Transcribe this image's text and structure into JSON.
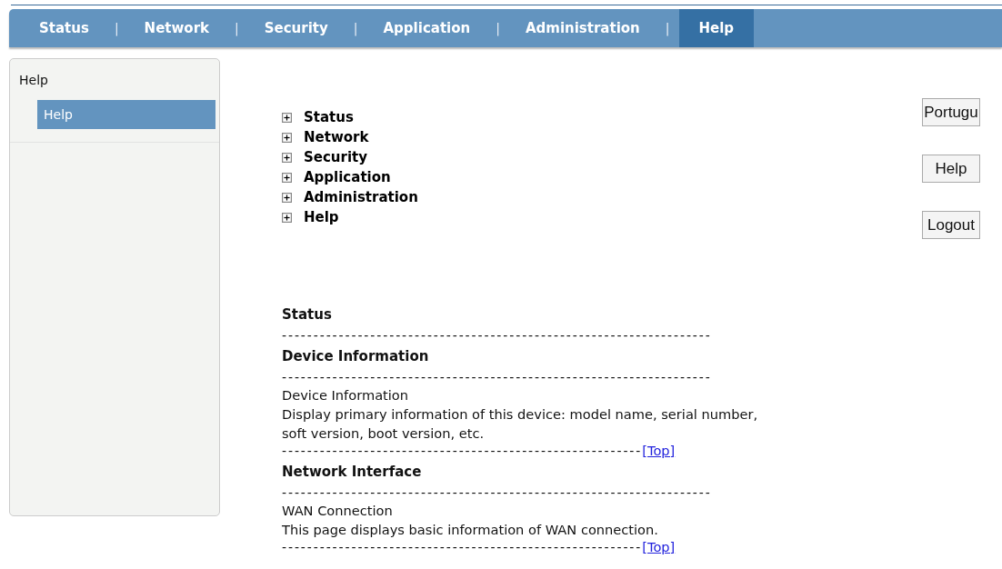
{
  "nav_tabs": [
    {
      "label": "Status",
      "selected": false
    },
    {
      "label": "Network",
      "selected": false
    },
    {
      "label": "Security",
      "selected": false
    },
    {
      "label": "Application",
      "selected": false
    },
    {
      "label": "Administration",
      "selected": false
    },
    {
      "label": "Help",
      "selected": true
    }
  ],
  "nav_separator": "|",
  "sidebar": {
    "title": "Help",
    "items": [
      {
        "label": "Help",
        "selected": true
      }
    ]
  },
  "tree": [
    {
      "label": "Status",
      "expanded": false
    },
    {
      "label": "Network",
      "expanded": false
    },
    {
      "label": "Security",
      "expanded": false
    },
    {
      "label": "Application",
      "expanded": false
    },
    {
      "label": "Administration",
      "expanded": false
    },
    {
      "label": "Help",
      "expanded": false
    }
  ],
  "buttons": [
    "Portugu",
    "Help",
    "Logout"
  ],
  "content": [
    {
      "kind": "heading",
      "text": "Status"
    },
    {
      "kind": "rule",
      "text": "--------------------------------------------------------------------"
    },
    {
      "kind": "heading",
      "text": "Device Information"
    },
    {
      "kind": "rule",
      "text": "--------------------------------------------------------------------"
    },
    {
      "kind": "text",
      "text": "Device Information"
    },
    {
      "kind": "text",
      "text": "Display primary information of this device: model name, serial number, soft version, boot version, etc."
    },
    {
      "kind": "top",
      "text": "---------------------------------------------------------",
      "link": "[Top]"
    },
    {
      "kind": "heading",
      "text": "Network Interface"
    },
    {
      "kind": "rule",
      "text": "--------------------------------------------------------------------"
    },
    {
      "kind": "text",
      "text": "WAN Connection"
    },
    {
      "kind": "text",
      "text": "This page displays basic information of WAN connection."
    },
    {
      "kind": "top",
      "text": "---------------------------------------------------------",
      "link": "[Top]"
    }
  ]
}
